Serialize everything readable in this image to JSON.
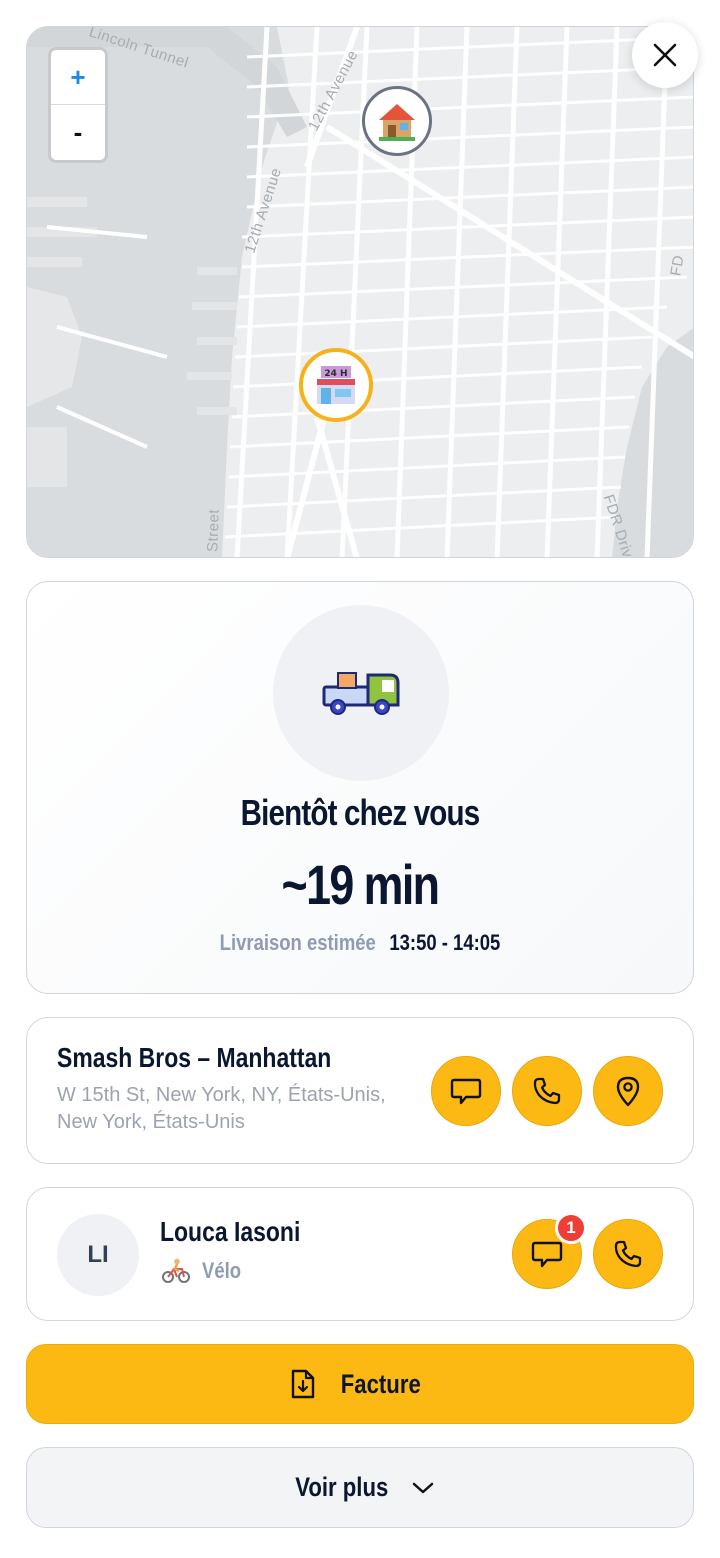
{
  "map": {
    "labels": {
      "tunnel": "Lincoln Tunnel",
      "avenue_top": "12th Avenue",
      "avenue_mid": "12th Avenue",
      "street_bottom": "Street",
      "fdr": "FDR Drive",
      "fd_right": "FD"
    },
    "zoom_in": "+",
    "zoom_out": "-",
    "destination_icon": "house-emoji",
    "store_icon": "convenience-store-emoji"
  },
  "eta": {
    "title": "Bientôt chez vous",
    "minutes": "~19 min",
    "window_label": "Livraison estimée",
    "window_value": "13:50 - 14:05"
  },
  "store": {
    "name": "Smash Bros – Manhattan",
    "address": "W 15th St, New York, NY, États-Unis, New York, États-Unis"
  },
  "courier": {
    "initials": "LI",
    "name": "Louca Iasoni",
    "vehicle": "Vélo",
    "unread_messages": "1"
  },
  "actions": {
    "invoice": "Facture",
    "more": "Voir plus"
  },
  "colors": {
    "accent": "#fdb913",
    "badge": "#ef3e36",
    "heading": "#0b1630",
    "muted": "#8f9bb0"
  }
}
